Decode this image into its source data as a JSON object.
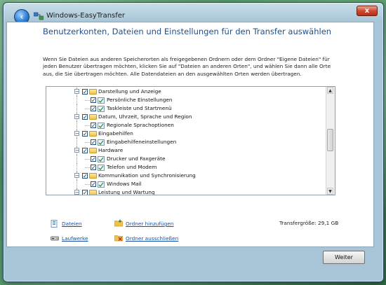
{
  "window": {
    "title": "Windows-EasyTransfer",
    "close_label": "x",
    "back_label": "‹"
  },
  "main": {
    "heading": "Benutzerkonten, Dateien und Einstellungen für den Transfer  auswählen",
    "description": "Wenn Sie Dateien aus anderen Speicherorten als freigegebenen Ordnern oder dem Ordner \"Eigene Dateien\" für jeden Benutzer übertragen möchten, klicken Sie auf \"Dateien an anderen Orten\", und wählen Sie dann alle Orte aus, die Sie übertragen möchten. Alle Datendateien an den ausgewählten Orten werden übertragen."
  },
  "tree": {
    "items": [
      {
        "label": "Darstellung und Anzeige",
        "kind": "folder",
        "level": 0,
        "expander": "−",
        "checked": true
      },
      {
        "label": "Persönliche Einstellungen",
        "kind": "setting",
        "level": 1,
        "checked": true
      },
      {
        "label": "Taskleiste und Startmenü",
        "kind": "setting",
        "level": 1,
        "checked": true
      },
      {
        "label": "Datum, Uhrzeit, Sprache und Region",
        "kind": "folder",
        "level": 0,
        "expander": "−",
        "checked": true
      },
      {
        "label": "Regionale Sprachoptionen",
        "kind": "setting",
        "level": 1,
        "checked": true
      },
      {
        "label": "Eingabehilfen",
        "kind": "folder",
        "level": 0,
        "expander": "−",
        "checked": true
      },
      {
        "label": "Eingabehilfeneinstellungen",
        "kind": "setting",
        "level": 1,
        "checked": true
      },
      {
        "label": "Hardware",
        "kind": "folder",
        "level": 0,
        "expander": "−",
        "checked": true
      },
      {
        "label": "Drucker und Faxgeräte",
        "kind": "setting",
        "level": 1,
        "checked": true
      },
      {
        "label": "Telefon und Modem",
        "kind": "setting",
        "level": 1,
        "checked": true
      },
      {
        "label": "Kommunikation und Synchronisierung",
        "kind": "folder",
        "level": 0,
        "expander": "−",
        "checked": true
      },
      {
        "label": "Windows Mail",
        "kind": "setting",
        "level": 1,
        "checked": true
      },
      {
        "label": "Leistung und Wartung",
        "kind": "folder",
        "level": 0,
        "expander": "−",
        "checked": true
      }
    ],
    "check_mark": "✓",
    "scroll_up": "▲",
    "scroll_down": "▼"
  },
  "actions": {
    "files": "Dateien",
    "drives": "Laufwerke",
    "add_folder": "Ordner hinzufügen",
    "exclude_folder": "Ordner ausschließen",
    "transfer_size": "Transfergröße: 29,1 GB"
  },
  "footer": {
    "next_label": "Weiter"
  },
  "colors": {
    "heading": "#1f4f8e",
    "link": "#1550a8"
  }
}
